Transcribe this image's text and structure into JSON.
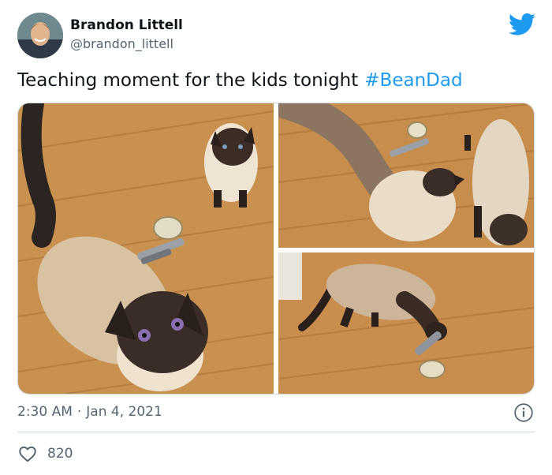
{
  "author": {
    "name": "Brandon Littell",
    "handle": "@brandon_littell"
  },
  "tweet": {
    "text": "Teaching moment for the kids tonight",
    "hashtag": "#BeanDad"
  },
  "meta": {
    "time": "2:30 AM",
    "separator": "·",
    "date": "Jan 4, 2021"
  },
  "engagement": {
    "likes": "820"
  },
  "icons": {
    "brand": "twitter-bird-icon",
    "info": "info-icon",
    "like": "heart-icon"
  },
  "colors": {
    "accent": "#1d9bf0",
    "secondary_text": "#536471",
    "border": "#cfd9de",
    "floor": "#c98d4c"
  }
}
